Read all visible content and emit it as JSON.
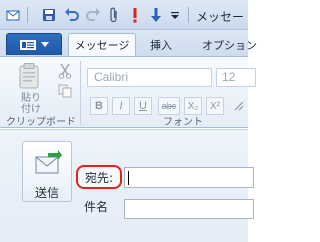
{
  "window": {
    "title": "メッセー"
  },
  "tabs": [
    {
      "label": "メッセージ",
      "active": true
    },
    {
      "label": "挿入",
      "active": false
    },
    {
      "label": "オプション",
      "active": false
    }
  ],
  "ribbon": {
    "clipboard": {
      "paste_label_line1": "貼り",
      "paste_label_line2": "付け",
      "group_label": "クリップボード"
    },
    "font": {
      "font_name": "Calibri",
      "font_size": "12",
      "group_label": "フォント",
      "format_buttons": [
        "B",
        "I",
        "U",
        "abc",
        "X₂",
        "X²"
      ]
    }
  },
  "compose": {
    "send_label": "送信",
    "to_label": "宛先:",
    "to_value": "",
    "subject_label": "件名",
    "subject_value": ""
  },
  "colors": {
    "highlight": "#e2231a",
    "accent": "#2a64b4"
  }
}
